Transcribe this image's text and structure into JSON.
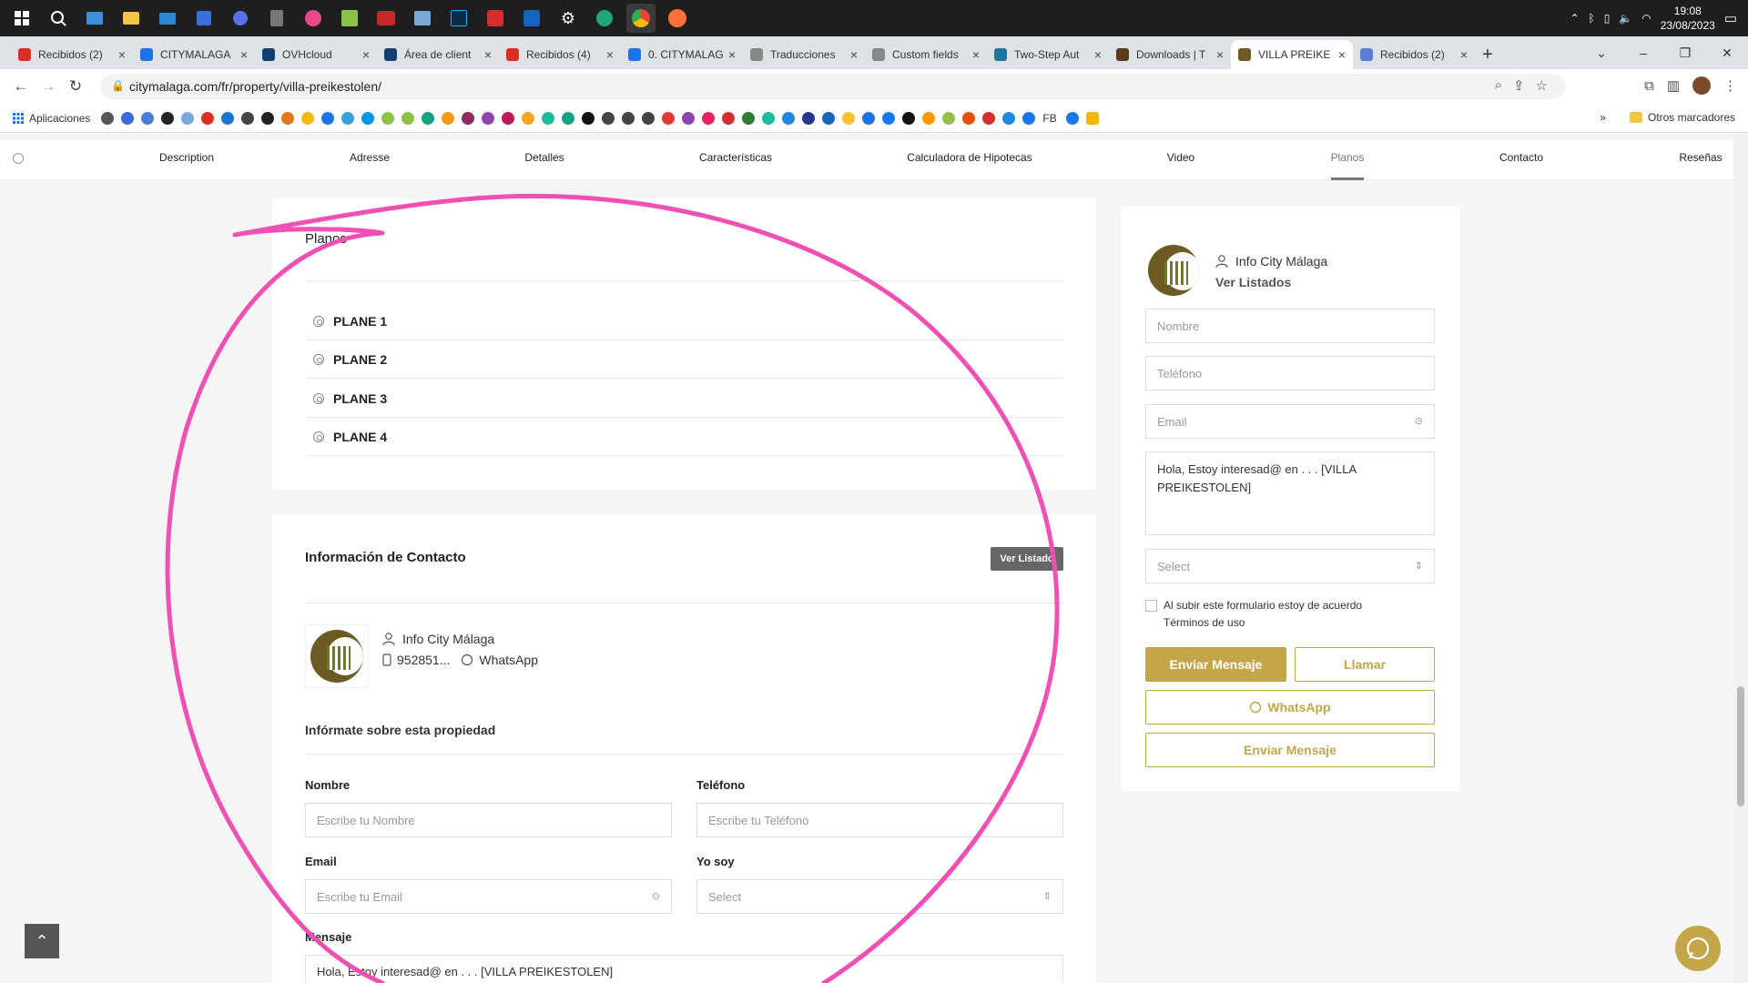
{
  "taskbar": {
    "time": "19:08",
    "date": "23/08/2023"
  },
  "tabs": [
    {
      "title": "Recibidos (2)",
      "favicon": "gmail-icon",
      "color": "#d93025"
    },
    {
      "title": "CITYMALAGA",
      "favicon": "drive-icon",
      "color": "#1a73e8"
    },
    {
      "title": "OVHcloud",
      "favicon": "ovh-icon",
      "color": "#123f6d"
    },
    {
      "title": "Área de client",
      "favicon": "ovh-icon",
      "color": "#123f6d"
    },
    {
      "title": "Recibidos (4)",
      "favicon": "gmail-icon",
      "color": "#d93025"
    },
    {
      "title": "0. CITYMALAG",
      "favicon": "drive-icon",
      "color": "#1a73e8"
    },
    {
      "title": "Traducciones",
      "favicon": "page-icon",
      "color": "#888888"
    },
    {
      "title": "Custom fields",
      "favicon": "page-icon",
      "color": "#888888"
    },
    {
      "title": "Two-Step Aut",
      "favicon": "wordpress-icon",
      "color": "#21759b"
    },
    {
      "title": "Downloads | T",
      "favicon": "downloads-icon",
      "color": "#5a3a1a"
    },
    {
      "title": "VILLA PREIKE",
      "favicon": "citymalaga-icon",
      "color": "#6b5a22",
      "active": true
    },
    {
      "title": "Recibidos (2)",
      "favicon": "mail-icon",
      "color": "#5b7fd6"
    }
  ],
  "address": {
    "url": "citymalaga.com/fr/property/villa-preikestolen/"
  },
  "bookmarks": {
    "apps_label": "Aplicaciones",
    "fb_label": "FB",
    "other_label": "Otros marcadores"
  },
  "propnav": {
    "items": [
      "Description",
      "Adresse",
      "Detalles",
      "Características",
      "Calculadora de Hipotecas",
      "Video",
      "Planos",
      "Contacto",
      "Reseñas"
    ],
    "active": "Planos"
  },
  "planos": {
    "title": "Planos",
    "items": [
      "PLANE 1",
      "PLANE 2",
      "PLANE 3",
      "PLANE 4"
    ]
  },
  "contact": {
    "title": "Información de Contacto",
    "ver_listado": "Ver Listado",
    "agent_name": "Info City Málaga",
    "phone": "952851...",
    "whatsapp": "WhatsApp",
    "subtitle": "Infórmate sobre esta propiedad",
    "form": {
      "nombre_label": "Nombre",
      "nombre_placeholder": "Escribe tu Nombre",
      "telefono_label": "Teléfono",
      "telefono_placeholder": "Escribe tu Teléfono",
      "email_label": "Email",
      "email_placeholder": "Escribe tu Email",
      "yosoy_label": "Yo soy",
      "yosoy_value": "Select",
      "mensaje_label": "Mensaje",
      "mensaje_value": "Hola, Estoy interesad@ en . . .  [VILLA PREIKESTOLEN]"
    }
  },
  "sidebar": {
    "agent_name": "Info City Málaga",
    "ver_listados": "Ver Listados",
    "nombre_placeholder": "Nombre",
    "telefono_placeholder": "Teléfono",
    "email_placeholder": "Email",
    "message": "Hola, Estoy interesad@ en . . .  [VILLA PREIKESTOLEN]",
    "select_value": "Select",
    "consent_text": "Al subir este formulario estoy de acuerdo",
    "terms_link": "Términos de uso",
    "enviar_mensaje": "Enviar Mensaje",
    "llamar": "Llamar",
    "whatsapp": "WhatsApp",
    "enviar_mensaje_2": "Enviar Mensaje"
  },
  "colors": {
    "gold": "#c4a64a",
    "annotation": "#f04fb4"
  }
}
